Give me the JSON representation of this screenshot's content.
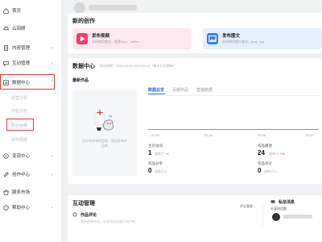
{
  "top": {
    "username": ""
  },
  "sidebar": {
    "items": [
      {
        "label": "首页",
        "icon": "home-icon",
        "expandable": false
      },
      {
        "label": "云回顾",
        "icon": "cloud-icon",
        "expandable": false
      },
      {
        "label": "内容管理",
        "icon": "document-icon",
        "expandable": true
      },
      {
        "label": "互动管理",
        "icon": "chat-icon",
        "expandable": true
      },
      {
        "label": "数据中心",
        "icon": "chart-icon",
        "expandable": true,
        "expanded": true
      },
      {
        "label": "变现中心",
        "icon": "money-icon",
        "expandable": true
      },
      {
        "label": "创作中心",
        "icon": "pen-icon",
        "expandable": true
      },
      {
        "label": "服务市场",
        "icon": "shop-icon",
        "expandable": false
      },
      {
        "label": "帮助中心",
        "icon": "help-icon",
        "expandable": true
      }
    ],
    "data_center_sub": [
      "经营分析",
      "内容分析",
      "粉丝画像",
      "创作周报"
    ]
  },
  "create": {
    "title": "新的创作",
    "video": {
      "title": "发布视频",
      "desc": "支持常用格式，推荐mp4、webm"
    },
    "image": {
      "title": "发布图文",
      "desc": "支持常用图片格式，png、jpg"
    }
  },
  "data_center": {
    "title": "数据中心",
    "update_note": "统计周期：2024-03-04-2024-03-10（每天12点更新）",
    "latest_works": "最新作品",
    "empty_text": "还没有发布作品哦，快去发布作品吧",
    "tabs": [
      "数据总览",
      "近期作品",
      "直播数据"
    ],
    "x_ticks": [
      "03-04",
      "03-05",
      "03-06",
      "03-07"
    ],
    "metrics": [
      {
        "label": "主页访问",
        "value": "1",
        "sub_prefix": "较昨日",
        "change": "+1"
      },
      {
        "label": "作品播放",
        "value": "24",
        "sub_prefix": "较昨日",
        "change": "+15"
      },
      {
        "label": "作品分享",
        "value": "0",
        "sub_prefix": "较昨日",
        "change": "0"
      },
      {
        "label": "作品评论",
        "value": "0",
        "sub_prefix": "较昨日",
        "change": "0"
      }
    ]
  },
  "interaction": {
    "title": "互动管理",
    "comments_label": "作品评论",
    "comments_desc": "暂未收到评论，去发布作品吸引用户吧",
    "more_label": "评论管理",
    "dm_label": "私信消息",
    "dm_sub": "分享的话题"
  },
  "colors": {
    "accent": "#2766f0",
    "highlight": "#e53935",
    "pink": "#fde8ef",
    "blue": "#e6effd"
  }
}
